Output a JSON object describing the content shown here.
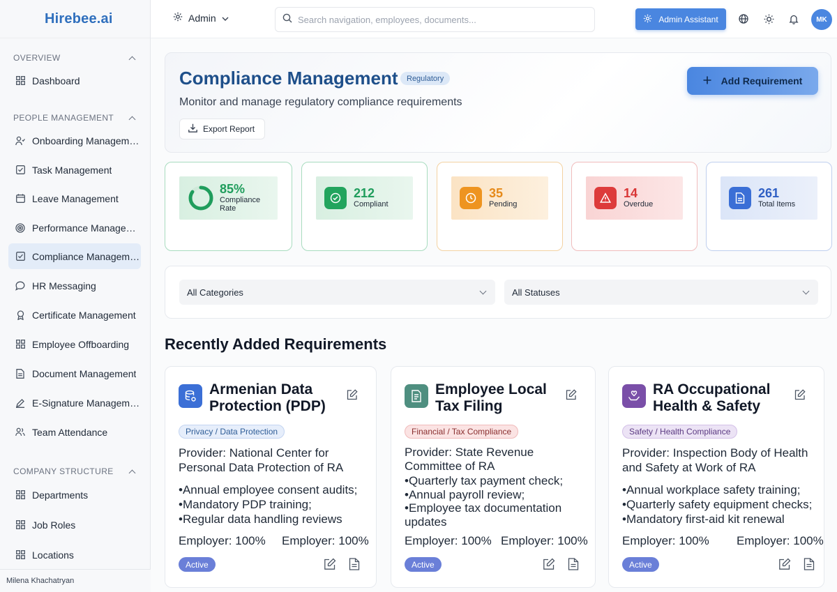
{
  "app": {
    "logo": "Hirebee.ai"
  },
  "sidebar": {
    "sections": [
      {
        "title": "OVERVIEW"
      },
      {
        "title": "PEOPLE MANAGEMENT"
      },
      {
        "title": "COMPANY STRUCTURE"
      }
    ],
    "items": [
      {
        "label": "Dashboard",
        "icon": "grid-icon"
      },
      {
        "label": "Onboarding Management",
        "icon": "user-plus-icon"
      },
      {
        "label": "Task Management",
        "icon": "checkbox-icon"
      },
      {
        "label": "Leave Management",
        "icon": "calendar-icon"
      },
      {
        "label": "Performance Management",
        "icon": "target-icon"
      },
      {
        "label": "Compliance Management",
        "icon": "checkbox-icon",
        "active": true
      },
      {
        "label": "HR Messaging",
        "icon": "message-icon"
      },
      {
        "label": "Certificate Management",
        "icon": "award-icon"
      },
      {
        "label": "Employee Offboarding",
        "icon": "grid-icon"
      },
      {
        "label": "Document Management",
        "icon": "file-icon"
      },
      {
        "label": "E-Signature Management",
        "icon": "pen-icon"
      },
      {
        "label": "Team Attendance",
        "icon": "users-icon"
      },
      {
        "label": "Departments",
        "icon": "grid-icon"
      },
      {
        "label": "Job Roles",
        "icon": "grid-icon"
      },
      {
        "label": "Locations",
        "icon": "grid-icon"
      }
    ],
    "user_name": "Milena Khachatryan"
  },
  "header": {
    "role": "Admin",
    "search_placeholder": "Search navigation, employees, documents...",
    "assistant_label": "Admin Assistant",
    "avatar_initials": "MK"
  },
  "hero": {
    "title": "Compliance Management",
    "badge": "Regulatory",
    "subtitle": "Monitor and manage regulatory compliance requirements",
    "export_label": "Export Report",
    "add_label": "Add Requirement"
  },
  "stats": [
    {
      "value": "85%",
      "label": "Compliance Rate",
      "color": "#1f9d5c"
    },
    {
      "value": "212",
      "label": "Compliant",
      "color": "#1f9d5c"
    },
    {
      "value": "35",
      "label": "Pending",
      "color": "#e68a1a"
    },
    {
      "value": "14",
      "label": "Overdue",
      "color": "#d93636"
    },
    {
      "value": "261",
      "label": "Total Items",
      "color": "#3b6fd6"
    }
  ],
  "compliance_rate_fraction": 0.85,
  "filters": {
    "category": "All Categories",
    "status": "All Statuses"
  },
  "section_title": "Recently Added Requirements",
  "cards": [
    {
      "title": "Armenian Data Protection (PDP)",
      "tag": "Privacy / Data Protection",
      "provider": "Provider: National Center for Personal Data Protection of RA",
      "items": [
        "Annual employee consent audits;",
        "Mandatory PDP training;",
        "Regular data handling reviews"
      ],
      "employer_a": "Employer: 100%",
      "employer_b": "Employer: 100%",
      "status": "Active",
      "icon_color": "#3b6fd6"
    },
    {
      "title": "Employee Local Tax Filing",
      "tag": "Financial / Tax Compliance",
      "provider": "Provider: State Revenue Committee of RA",
      "items": [
        "Quarterly tax payment check;",
        "Annual payroll review;",
        "Employee tax documentation updates"
      ],
      "employer_a": "Employer: 100%",
      "employer_b": "Employer: 100%",
      "status": "Active",
      "icon_color": "#4f8f80"
    },
    {
      "title": "RA Occupational Health & Safety",
      "tag": "Safety / Health Compliance",
      "provider": "Provider: Inspection Body of Health and Safety at Work of RA",
      "items": [
        "Annual workplace safety training;",
        "Quarterly safety equipment checks;",
        "Mandatory first-aid kit renewal"
      ],
      "employer_a": "Employer: 100%",
      "employer_b": "Employer: 100%",
      "status": "Active",
      "icon_color": "#7a4fa8"
    }
  ]
}
